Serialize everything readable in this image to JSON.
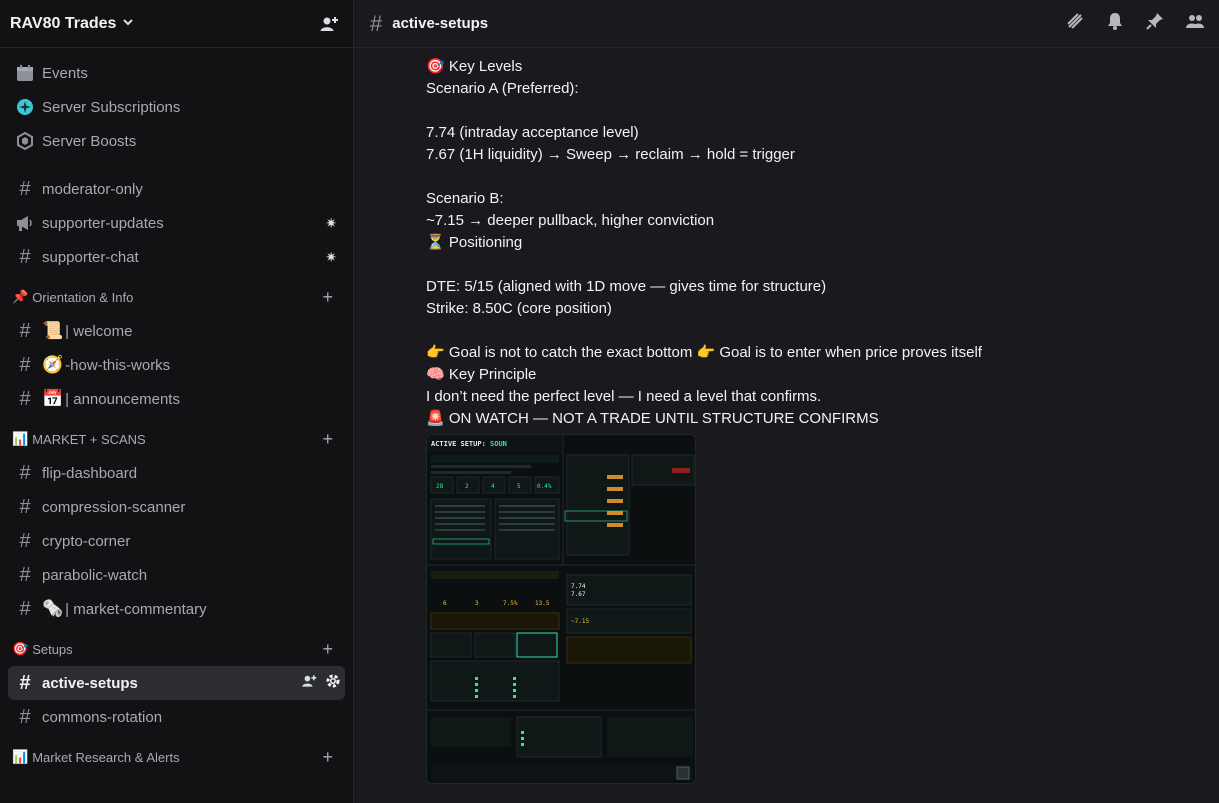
{
  "server": {
    "name": "RAV80 Trades"
  },
  "sidebar": {
    "top_items": [
      {
        "label": "Events"
      },
      {
        "label": "Server Subscriptions"
      },
      {
        "label": "Server Boosts"
      }
    ],
    "channels_top": [
      {
        "label": "moderator-only"
      },
      {
        "label": "supporter-updates"
      },
      {
        "label": "supporter-chat"
      }
    ],
    "categories": [
      {
        "emoji": "📌",
        "label": "Orientation & Info"
      },
      {
        "emoji": "📊",
        "label": "MARKET + SCANS"
      },
      {
        "emoji": "🎯",
        "label": "Setups"
      },
      {
        "emoji": "📊",
        "label": "Market Research & Alerts"
      }
    ],
    "orientation": [
      {
        "emoji": "📜",
        "label": "| welcome"
      },
      {
        "emoji": "🧭",
        "label": "-how-this-works"
      },
      {
        "emoji": "📅",
        "label": "| announcements"
      }
    ],
    "market": [
      {
        "label": "flip-dashboard"
      },
      {
        "label": "compression-scanner"
      },
      {
        "label": "crypto-corner"
      },
      {
        "label": "parabolic-watch"
      },
      {
        "emoji": "🗞️",
        "label": "| market-commentary"
      }
    ],
    "setups": [
      {
        "label": "active-setups"
      },
      {
        "label": "commons-rotation"
      }
    ]
  },
  "channel": {
    "name": "active-setups"
  },
  "message": {
    "lines": [
      "🎯 Key Levels",
      "Scenario A (Preferred):",
      "",
      "7.74 (intraday acceptance level)",
      "7.67 (1H liquidity) → Sweep → reclaim → hold = trigger",
      "",
      "Scenario B:",
      "~7.15  → deeper pullback, higher conviction",
      "⏳ Positioning",
      "",
      "DTE: 5/15 (aligned with 1D move — gives time for structure)",
      "Strike: 8.50C (core position)",
      "",
      "👉 Goal is not to catch the exact bottom 👉 Goal is to enter when price proves itself",
      "🧠 Key Principle",
      "I don’t need the perfect level — I need a level that confirms.",
      "🚨 ON WATCH — NOT A TRADE UNTIL STRUCTURE CONFIRMS"
    ]
  },
  "attachment": {
    "header": "ACTIVE SETUP:",
    "ticker": "SOUN",
    "stats_1": [
      "28",
      "2",
      "4",
      "5",
      "0.4%"
    ],
    "stats_2": [
      "6",
      "3",
      "7.5%",
      "13.5"
    ],
    "level_a": "7.74",
    "level_b": "7.67",
    "level_c": "~7.15"
  },
  "colors": {
    "accent": "#5865f2",
    "attach_green": "#2ee6a8",
    "attach_orange": "#d18a2b"
  }
}
